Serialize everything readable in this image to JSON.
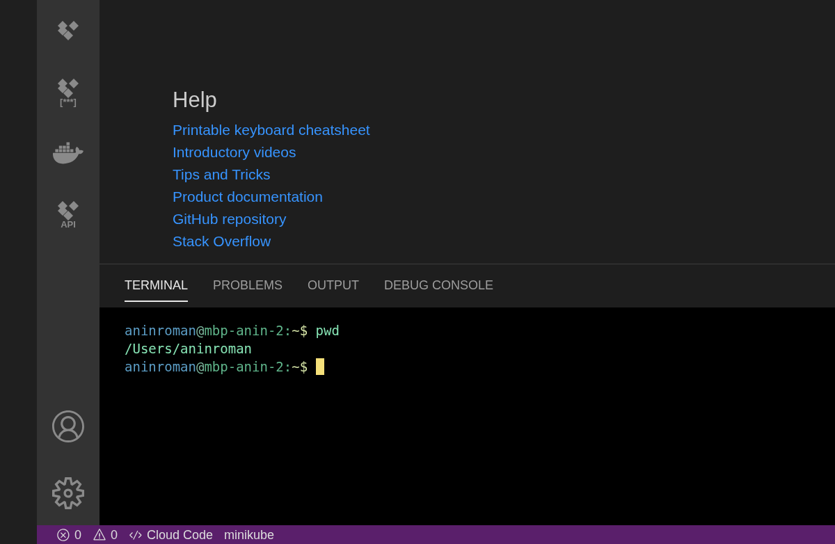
{
  "activity_bar": {
    "items": [
      {
        "kind": "diamonds"
      },
      {
        "kind": "diamonds",
        "label": "[***]"
      },
      {
        "kind": "docker"
      },
      {
        "kind": "diamonds",
        "label": "API"
      }
    ],
    "bottom_items": [
      {
        "kind": "account"
      },
      {
        "kind": "settings"
      }
    ]
  },
  "help": {
    "title": "Help",
    "links": [
      "Printable keyboard cheatsheet",
      "Introductory videos",
      "Tips and Tricks",
      "Product documentation",
      "GitHub repository",
      "Stack Overflow"
    ]
  },
  "panel": {
    "tabs": [
      {
        "label": "TERMINAL",
        "selected": true
      },
      {
        "label": "PROBLEMS",
        "selected": false
      },
      {
        "label": "OUTPUT",
        "selected": false
      },
      {
        "label": "DEBUG CONSOLE",
        "selected": false
      }
    ],
    "terminal_lines": [
      {
        "segments": [
          {
            "kind": "user",
            "text": "aninroman"
          },
          {
            "kind": "at",
            "text": "@"
          },
          {
            "kind": "host",
            "text": "mbp-anin-2:"
          },
          {
            "kind": "prompt",
            "text": "~$ "
          },
          {
            "kind": "command",
            "text": "pwd"
          }
        ],
        "cursor": false
      },
      {
        "segments": [
          {
            "kind": "output",
            "text": "/Users/aninroman"
          }
        ],
        "cursor": false
      },
      {
        "segments": [
          {
            "kind": "user",
            "text": "aninroman"
          },
          {
            "kind": "at",
            "text": "@"
          },
          {
            "kind": "host",
            "text": "mbp-anin-2:"
          },
          {
            "kind": "prompt",
            "text": "~$ "
          }
        ],
        "cursor": true
      }
    ]
  },
  "status_bar": {
    "items": [
      {
        "kind": "errors",
        "text": "0"
      },
      {
        "kind": "warnings",
        "text": "0"
      },
      {
        "kind": "code",
        "text": "Cloud Code"
      },
      {
        "kind": "plain",
        "text": "minikube"
      }
    ]
  }
}
